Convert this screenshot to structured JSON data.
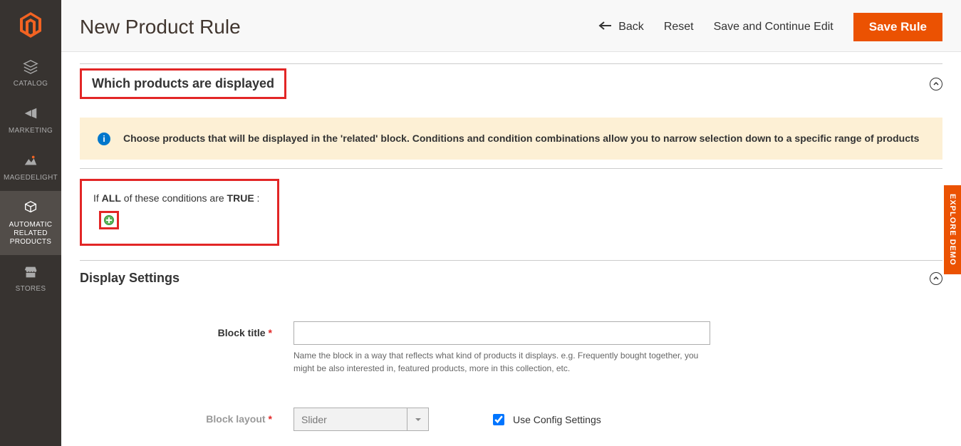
{
  "header": {
    "title": "New Product Rule",
    "back": "Back",
    "reset": "Reset",
    "save_continue": "Save and Continue Edit",
    "save": "Save Rule"
  },
  "sidebar": {
    "items": [
      {
        "label": "CATALOG"
      },
      {
        "label": "MARKETING"
      },
      {
        "label": "MAGEDELIGHT"
      },
      {
        "label": "AUTOMATIC RELATED PRODUCTS"
      },
      {
        "label": "STORES"
      }
    ]
  },
  "sections": {
    "displayed": {
      "title": "Which products are displayed",
      "info": "Choose products that will be displayed in the 'related' block. Conditions and condition combinations allow you to narrow selection down to a specific range of products",
      "conditions_prefix": "If ",
      "conditions_all": "ALL",
      "conditions_mid": "  of these conditions are ",
      "conditions_true": "TRUE",
      "conditions_suffix": " :"
    },
    "display_settings": {
      "title": "Display Settings",
      "block_title_label": "Block title",
      "block_title_hint": "Name the block in a way that reflects what kind of products it displays. e.g. Frequently bought together, you might be also interested in, featured products, more in this collection, etc.",
      "block_layout_label": "Block layout",
      "block_layout_value": "Slider",
      "use_config_label": "Use Config Settings"
    }
  },
  "explore_tab": "EXPLORE DEMO"
}
